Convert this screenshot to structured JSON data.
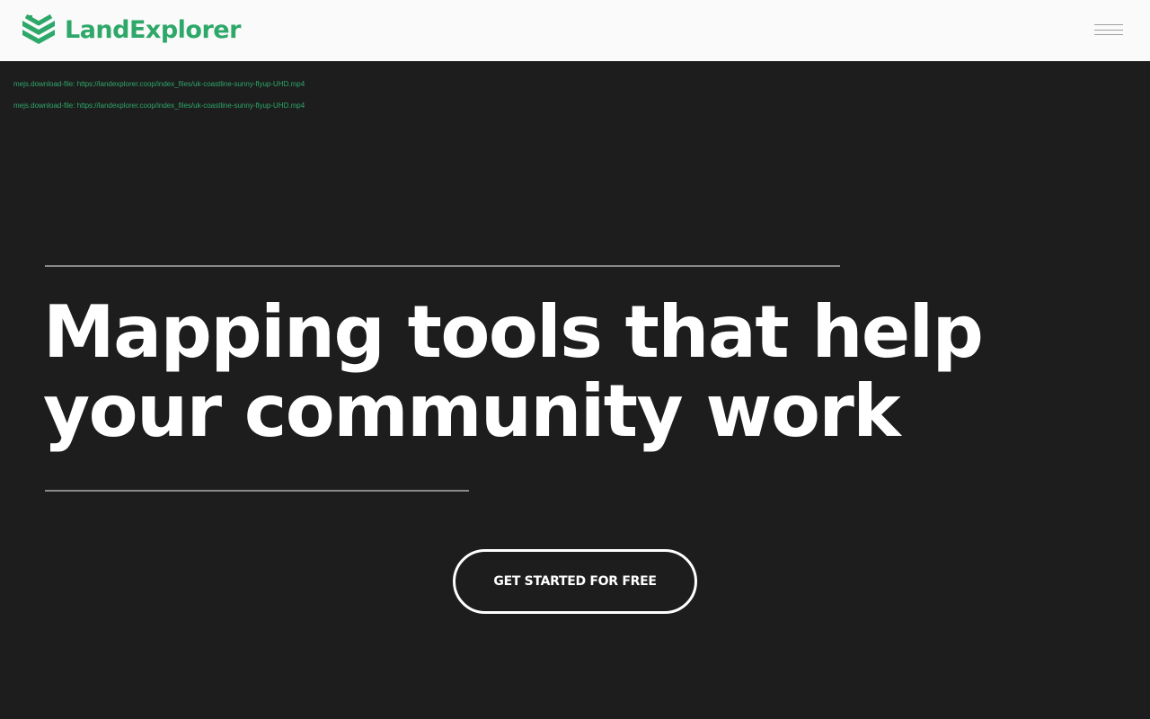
{
  "header": {
    "brand_name": "LandExplorer",
    "brand_color": "#2ea869",
    "logo_icon": "layered-map-check-icon",
    "menu_icon": "hamburger-menu-icon"
  },
  "hero": {
    "debug_lines": [
      "mejs.download-file: https://landexplorer.coop/index_files/uk-coastline-sunny-flyup-UHD.mp4",
      "mejs.download-file: https://landexplorer.coop/index_files/uk-coastline-sunny-flyup-UHD.mp4"
    ],
    "headline": "Mapping tools that help your community work",
    "cta_label": "GET STARTED FOR FREE"
  },
  "colors": {
    "background": "#1d1d1d",
    "header_background": "#fafafa",
    "headline": "#ffffff",
    "rule": "#8a8a8a"
  }
}
